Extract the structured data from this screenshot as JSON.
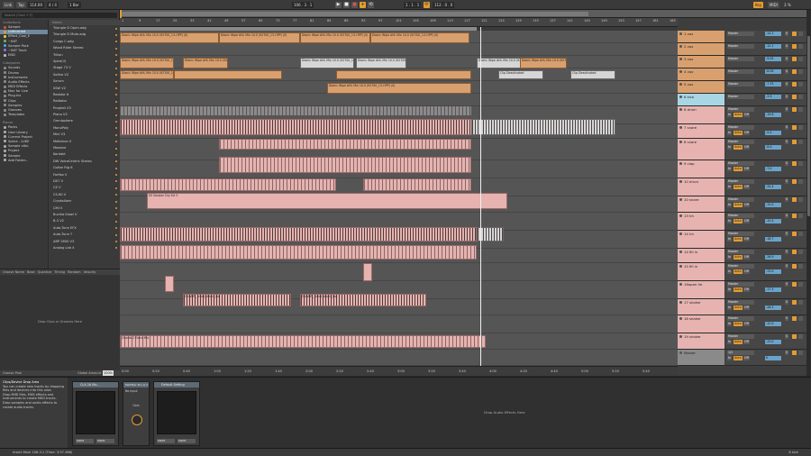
{
  "transport": {
    "link": "Link",
    "tap": "Tap",
    "tempo": "114.00",
    "signature": "4 / 4",
    "bar": "1 Bar",
    "position": "106 . 3 . 1",
    "loop_start": "1 . 1 . 1",
    "loop_length": "112 . 0 . 0",
    "key": "Key",
    "midi": "MIDI",
    "cpu": "3 %"
  },
  "browser": {
    "search_placeholder": "Search (Cmd + F)",
    "collections_title": "Collections",
    "collections": [
      {
        "label": "Sample",
        "color": "#d84b4b"
      },
      {
        "label": "Unfinished",
        "color": "#e29b3b",
        "selected": true
      },
      {
        "label": "Effect_Cool_E",
        "color": "#e3c53b"
      },
      {
        "label": "~INIT",
        "color": "#62b45a"
      },
      {
        "label": "Sample Pack",
        "color": "#4aa3d8"
      },
      {
        "label": "~INIT Track",
        "color": "#9a6bd8"
      },
      {
        "label": "END",
        "color": "#b6b6b6"
      }
    ],
    "categories_title": "Categories",
    "categories": [
      "Sounds",
      "Drums",
      "Instruments",
      "Audio Effects",
      "MIDI Effects",
      "Max for Live",
      "Plug-Ins",
      "Clips",
      "Samples",
      "Grooves",
      "Templates"
    ],
    "places_title": "Places",
    "places": [
      "Packs",
      "User Library",
      "Current Project",
      "Splice - LUKE",
      "Sample vAIo",
      "Project",
      "Sample",
      "Add Folder..."
    ],
    "name_header": "Name",
    "items": [
      "Triangle D Open.adg",
      "Triangle D Mute.adg",
      "Congs C.adg",
      "Wood Rider Stereo",
      "Trilian",
      "Spire(V)",
      "Stage 73 V",
      "Sofina V2",
      "Serum",
      "SSW V2",
      "Reaktor 6",
      "Radiator",
      "Prophet V3",
      "Piano V3",
      "Omnisphere",
      "MonoPoly",
      "Mini V3",
      "Mellotron V",
      "Massive",
      "Kontakt",
      "DW VoiceCentric Stereo",
      "Guitar Rig 6",
      "Farfisa V",
      "DX7 V",
      "CZ V",
      "CS-80 V",
      "Crystallizer",
      "CMI V",
      "Buchla Easel V",
      "B-3 V2",
      "Auto-Tune EFX",
      "Auto-Tune 7",
      "ARP 2600 V3",
      "Analog Lab 4"
    ],
    "groove_headers": [
      "Groove Name",
      "Base",
      "Quantize",
      "Timing",
      "Random",
      "Velocity"
    ],
    "groove_drop": "Drop Clips or Grooves Here",
    "groove_pool": "Groove Pool",
    "global_amount_label": "Global Amount",
    "global_amount": "100%"
  },
  "ruler": [
    "1",
    "9",
    "17",
    "25",
    "33",
    "41",
    "49",
    "57",
    "65",
    "73",
    "77",
    "81",
    "85",
    "89",
    "93",
    "97",
    "101",
    "105",
    "109",
    "113",
    "117",
    "121",
    "125",
    "129",
    "133",
    "137",
    "141",
    "145",
    "149",
    "153",
    "157",
    "161",
    "165"
  ],
  "timebar": [
    "0:00",
    "0:20",
    "0:40",
    "1:00",
    "1:20",
    "1:40",
    "2:00",
    "2:20",
    "2:40",
    "3:00",
    "3:20",
    "3:40",
    "4:00",
    "4:20",
    "4:40",
    "5:00",
    "5:20",
    "5:40"
  ],
  "clip_labels": {
    "wipe_a": "Dionic Wipe AHL Mix 10.0 (92700_13-OPP) (0)",
    "wipe_b": "Dionic Wipe AHL Mix 10.0 (92700_13-OPP) (0)",
    "deactivated": "Clip Deactivated",
    "session_kit": "00 Session Dry Kit 3",
    "drum_hihat": "OLIVER_ hihat_drum_loo",
    "chords": "Chords 2 Extra Mix"
  },
  "tracks": [
    {
      "name": "1 vox",
      "color": "#d9a06f",
      "send": "Master"
    },
    {
      "name": "2 vox",
      "color": "#d9a06f",
      "send": "Master"
    },
    {
      "name": "3 vox",
      "color": "#d9a06f",
      "send": "Master"
    },
    {
      "name": "4 vox",
      "color": "#d9a06f",
      "send": "Master"
    },
    {
      "name": "5 vox",
      "color": "#d9a06f",
      "send": "Master"
    },
    {
      "name": "6 kick",
      "color": "#a9d6e5",
      "send": "Master"
    },
    {
      "name": "6 drum",
      "color": "#e6b3b0",
      "send": "Master"
    },
    {
      "name": "7 snare",
      "color": "#e6b3b0",
      "send": "Master"
    },
    {
      "name": "8 snare",
      "color": "#e6b3b0",
      "send": "Master"
    },
    {
      "name": "9 clap",
      "color": "#e6b3b0",
      "send": "Master"
    },
    {
      "name": "10 drum",
      "color": "#e6b3b0",
      "send": "Master"
    },
    {
      "name": "10 snare",
      "color": "#e6b3b0",
      "send": "Master"
    },
    {
      "name": "13 hh",
      "color": "#e6b3b0",
      "send": "Master"
    },
    {
      "name": "14 hh",
      "color": "#e6b3b0",
      "send": "Master"
    },
    {
      "name": "14 fill in",
      "color": "#e6b3b0",
      "send": "Master"
    },
    {
      "name": "15 fill in",
      "color": "#e6b3b0",
      "send": "Master"
    },
    {
      "name": "16open hh",
      "color": "#e6b3b0",
      "send": "Master"
    },
    {
      "name": "17 shaker",
      "color": "#e6b3b0",
      "send": "Master"
    },
    {
      "name": "18 shaker",
      "color": "#e6b3b0",
      "send": "Master"
    },
    {
      "name": "19 shaker",
      "color": "#e6b3b0",
      "send": "Master"
    },
    {
      "name": "Master",
      "color": "#8a8a8a",
      "send": "1/2"
    }
  ],
  "mixer_values": [
    "-14.2",
    "-12.1",
    "-9.05",
    "-8.09",
    "-7.33",
    "-3.9",
    "-19.8",
    "-5.4",
    "-8.0",
    "-7.0",
    "-20.4",
    "-12.0",
    "-15.4",
    "-18.7",
    "-26.9",
    "-13.0",
    "-17.3",
    "-26.5",
    "-12.0",
    "-13.0",
    "0"
  ],
  "mixer_labels": {
    "in": "In",
    "auto": "Auto",
    "off": "Off",
    "master": "Master",
    "s": "S"
  },
  "device": {
    "info_title": "Clips/Device Drop Area",
    "info_body": "You can create new tracks by dropping files and devices into this area.",
    "info_bullets": [
      "Drop MIDI files, MIDI effects and instruments to create MIDI tracks.",
      "Drop samples and audio effects to create audio tracks."
    ],
    "device1_title": "CLA 2A Mo...",
    "device2_title": "FabFilter Pro-Q 3",
    "device2_sub": "No Input",
    "device3_title": "Default Setting",
    "knob_label": "Gain",
    "knob_value": "0 dB",
    "dropdown": "none",
    "drop_fx": "Drop Audio Effects Here"
  },
  "status": {
    "left": "Insert Mark 106.3.1 (Time: 3:37.368)",
    "right": "6 kick"
  }
}
